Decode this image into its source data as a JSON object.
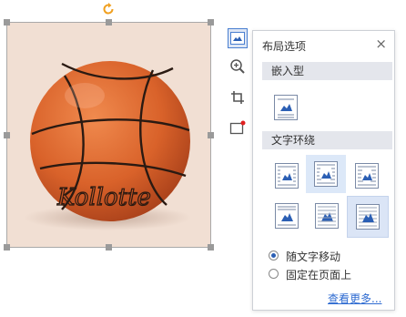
{
  "panel": {
    "title": "布局选项",
    "close_glyph": "×",
    "inline_section": "嵌入型",
    "wrap_section": "文字环绕",
    "radio_move": "随文字移动",
    "radio_fixed": "固定在页面上",
    "see_more": "查看更多...",
    "selected_radio": "随文字移动"
  },
  "image": {
    "subject": "basketball",
    "ball_text": "Kollotte"
  },
  "tools": [
    "layout-options-icon",
    "zoom-icon",
    "crop-icon",
    "border-icon"
  ],
  "colors": {
    "accent": "#4a7fd0",
    "link": "#2e6bd1",
    "rotate": "#f0a020",
    "ball": "#d9622a"
  }
}
